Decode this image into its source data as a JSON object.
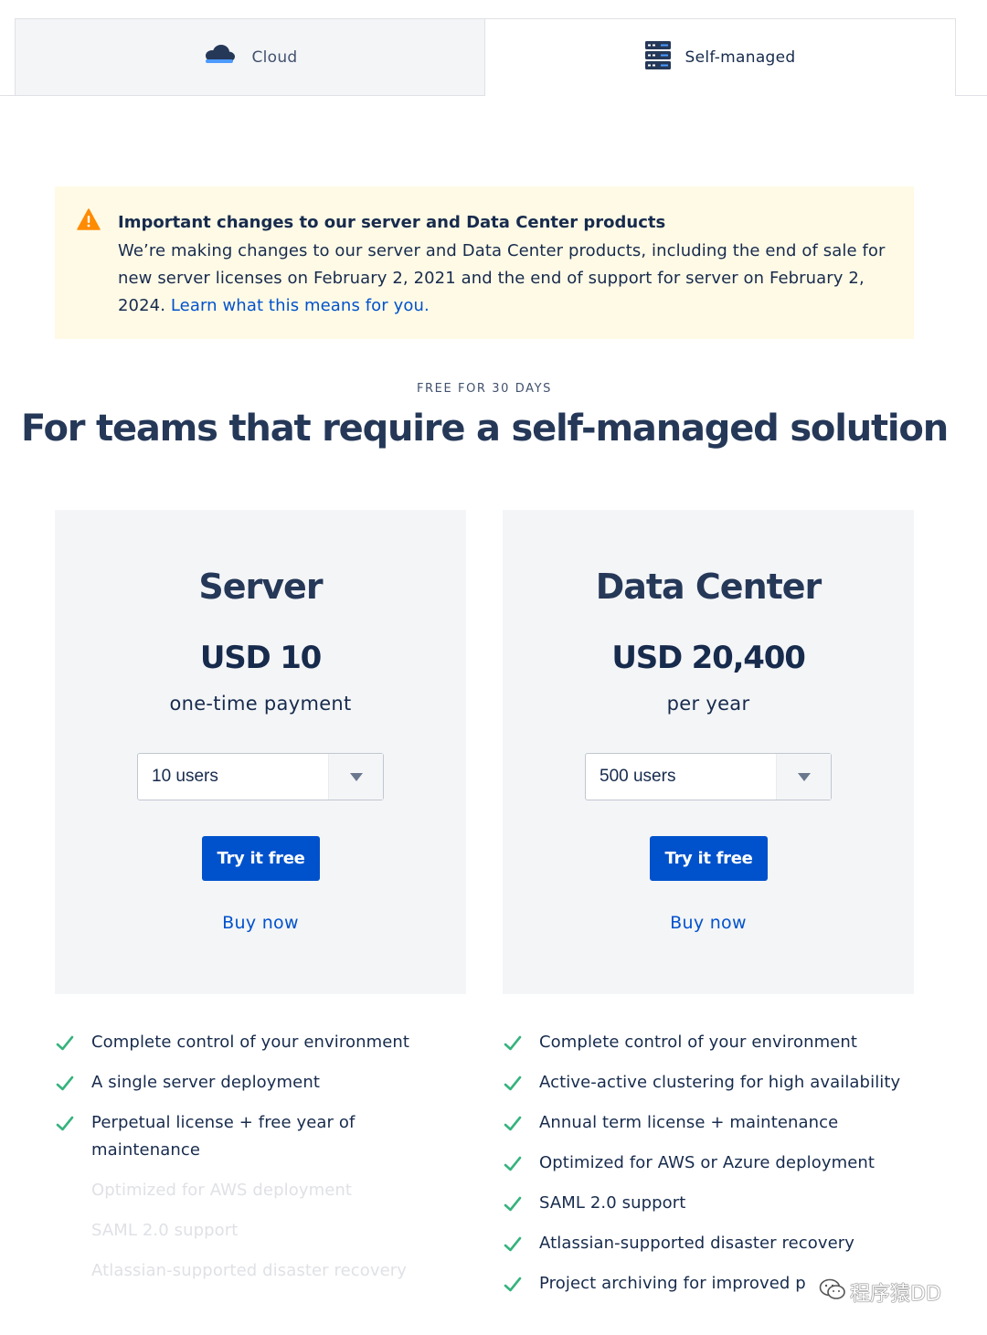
{
  "tabs": {
    "cloud": {
      "label": "Cloud",
      "icon": "cloud-icon"
    },
    "self_managed": {
      "label": "Self-managed",
      "icon": "server-rack-icon"
    }
  },
  "banner": {
    "icon": "warning-icon",
    "title": "Important changes to our server and Data Center products",
    "body": "We’re making changes to our server and Data Center products, including the end of sale for new server licenses on February 2, 2021 and the end of support for server on February 2, 2024. ",
    "link": "Learn what this means for you."
  },
  "eyebrow": "FREE FOR 30 DAYS",
  "headline": "For teams that require a self-managed solution",
  "plans": [
    {
      "name": "Server",
      "price": "USD 10",
      "term": "one-time payment",
      "users_selected": "10 users",
      "try_label": "Try it free",
      "buy_label": "Buy now",
      "features": [
        {
          "text": "Complete control of your environment",
          "included": true
        },
        {
          "text": "A single server deployment",
          "included": true
        },
        {
          "text": "Perpetual license + free year of maintenance",
          "included": true
        },
        {
          "text": "Optimized for AWS deployment",
          "included": false
        },
        {
          "text": "SAML 2.0 support",
          "included": false
        },
        {
          "text": "Atlassian-supported disaster recovery",
          "included": false
        }
      ]
    },
    {
      "name": "Data Center",
      "price": "USD 20,400",
      "term": "per year",
      "users_selected": "500 users",
      "try_label": "Try it free",
      "buy_label": "Buy now",
      "features": [
        {
          "text": "Complete control of your environment",
          "included": true
        },
        {
          "text": "Active-active clustering for high availability",
          "included": true
        },
        {
          "text": "Annual term license + maintenance",
          "included": true
        },
        {
          "text": "Optimized for AWS or Azure deployment",
          "included": true
        },
        {
          "text": "SAML 2.0 support",
          "included": true
        },
        {
          "text": "Atlassian-supported disaster recovery",
          "included": true
        },
        {
          "text": "Project archiving for improved p",
          "included": true
        }
      ]
    }
  ],
  "watermark": "程序猿DD",
  "colors": {
    "accent": "#0052cc",
    "check": "#36b37e",
    "warning": "#ff8b00",
    "banner_bg": "#fffae6",
    "card_bg": "#f4f5f7",
    "heading": "#253858"
  }
}
